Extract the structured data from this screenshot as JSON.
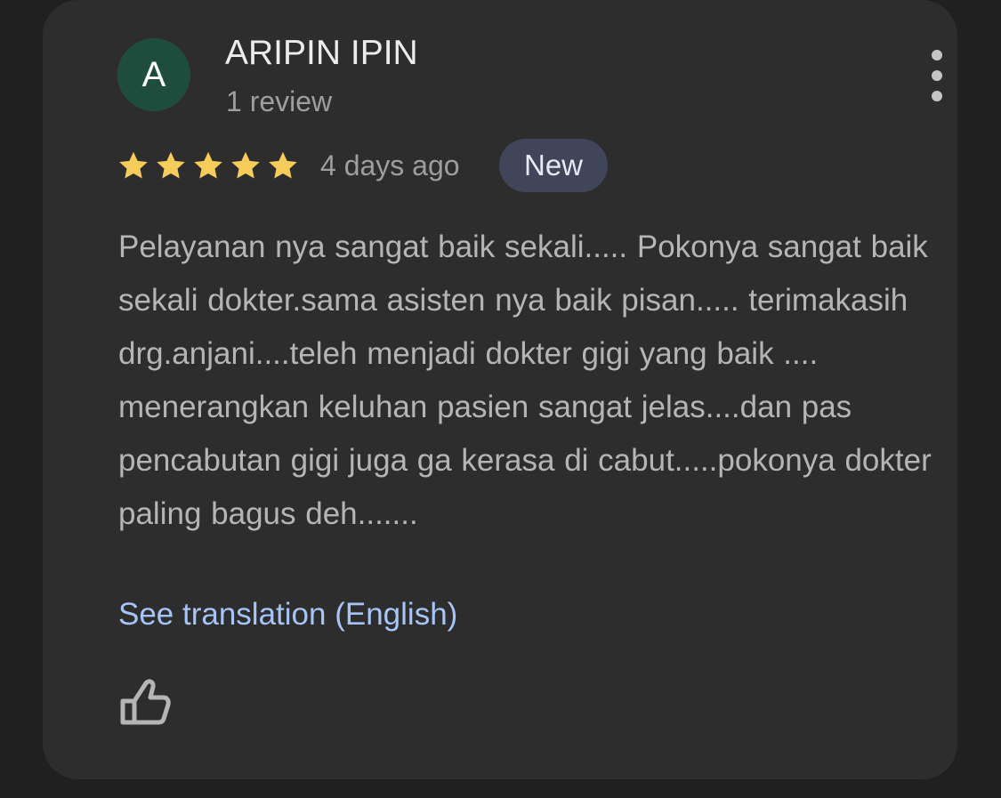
{
  "review": {
    "avatar_initial": "A",
    "author_name": "ARIPIN IPIN",
    "review_count": "1 review",
    "rating": 5,
    "rating_max": 5,
    "date": "4 days ago",
    "badge": "New",
    "text": "Pelayanan nya sangat baik sekali..... Pokonya sangat baik sekali dokter.sama asisten nya baik pisan..... terimakasih drg.anjani....teleh menjadi dokter gigi yang baik .... menerangkan keluhan pasien sangat jelas....dan pas pencabutan gigi juga ga kerasa di cabut.....pokonya dokter paling bagus deh.......",
    "translation_link": "See translation (English)"
  },
  "icons": {
    "more": "more-vert-icon",
    "star": "star-icon",
    "like": "thumbs-up-icon"
  },
  "colors": {
    "background": "#202020",
    "card": "#2d2d2d",
    "avatar": "#1e4d3e",
    "star": "#f6cc5a",
    "badge": "#41455a",
    "link": "#a6c4f5"
  }
}
